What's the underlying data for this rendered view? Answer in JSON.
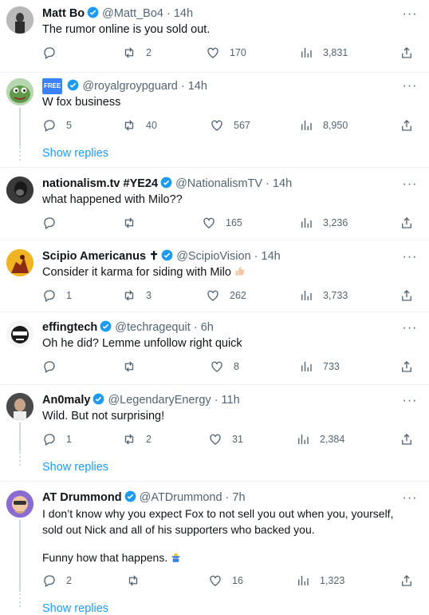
{
  "colors": {
    "accent": "#1d9bf0",
    "muted": "#536471",
    "text": "#0f1419",
    "divider": "#eff3f4"
  },
  "show_replies_label": "Show replies",
  "replies": [
    {
      "name": "Matt Bo",
      "handle": "@Matt_Bo4",
      "time": "· 14h",
      "text": [
        "The rumor online is you sold out."
      ],
      "stats": {
        "replies": "",
        "reposts": "2",
        "likes": "170",
        "views": "3,831"
      },
      "show_replies": false
    },
    {
      "name": "",
      "handle": "@royalgroypguard",
      "time": "· 14h",
      "badge": "FREE",
      "text": [
        "W fox business"
      ],
      "stats": {
        "replies": "5",
        "reposts": "40",
        "likes": "567",
        "views": "8,950"
      },
      "show_replies": true
    },
    {
      "name": "nationalism.tv #YE24",
      "handle": "@NationalismTV",
      "time": "· 14h",
      "text": [
        "what happened with Milo??"
      ],
      "stats": {
        "replies": "",
        "reposts": "",
        "likes": "165",
        "views": "3,236"
      },
      "show_replies": false
    },
    {
      "name": "Scipio Americanus ✝",
      "handle": "@ScipioVision",
      "time": "· 14h",
      "text": [
        "Consider it karma for siding with Milo"
      ],
      "stats": {
        "replies": "1",
        "reposts": "3",
        "likes": "262",
        "views": "3,733"
      },
      "show_replies": false
    },
    {
      "name": "effingtech",
      "handle": "@techragequit",
      "time": "· 6h",
      "text": [
        "Oh he did? Lemme unfollow right quick"
      ],
      "stats": {
        "replies": "",
        "reposts": "",
        "likes": "8",
        "views": "733"
      },
      "show_replies": false
    },
    {
      "name": "An0maly",
      "handle": "@LegendaryEnergy",
      "time": "· 11h",
      "text": [
        "Wild. But not surprising!"
      ],
      "stats": {
        "replies": "1",
        "reposts": "2",
        "likes": "31",
        "views": "2,384"
      },
      "show_replies": true
    },
    {
      "name": "AT Drummond",
      "handle": "@ATDrummond",
      "time": "· 7h",
      "text": [
        "I don’t know why you expect Fox to not sell you out when you, yourself,",
        "sold out Nick and all of his supporters who backed you.",
        "",
        "Funny how that happens."
      ],
      "stats": {
        "replies": "2",
        "reposts": "",
        "likes": "16",
        "views": "1,323"
      },
      "show_replies": true
    }
  ]
}
